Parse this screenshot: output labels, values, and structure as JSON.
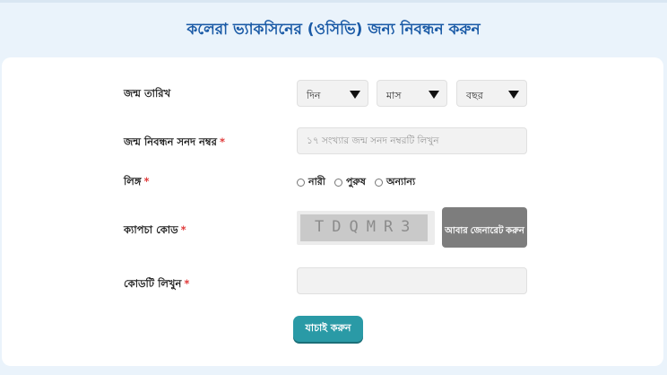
{
  "header": {
    "title": "কলেরা ভ্যাকসিনের (ওসিভি) জন্য নিবন্ধন করুন"
  },
  "form": {
    "dob": {
      "label": "জন্ম তারিখ",
      "day": "দিন",
      "month": "মাস",
      "year": "বছর"
    },
    "birth_reg": {
      "label": "জন্ম নিবন্ধন সনদ নম্বর",
      "required": "*",
      "placeholder": "১৭ সংখ্যার জন্ম সনদ নম্বরটি লিখুন",
      "value": ""
    },
    "gender": {
      "label": "লিঙ্গ",
      "required": "*",
      "options": [
        "নারী",
        "পুরুষ",
        "অন্যান্য"
      ]
    },
    "captcha": {
      "label": "ক্যাপচা কোড",
      "required": "*",
      "code": "TDQMR3",
      "regenerate_label": "আবার জেনারেট করুন"
    },
    "code_entry": {
      "label": "কোডটি লিখুন",
      "required": "*",
      "placeholder": "",
      "value": ""
    },
    "submit_label": "যাচাই করুন"
  },
  "colors": {
    "title": "#1a5aa6",
    "required": "#e03a3a",
    "submit": "#2a9aa6",
    "regenerate": "#7d7d7d",
    "background": "#eaf3fb"
  }
}
